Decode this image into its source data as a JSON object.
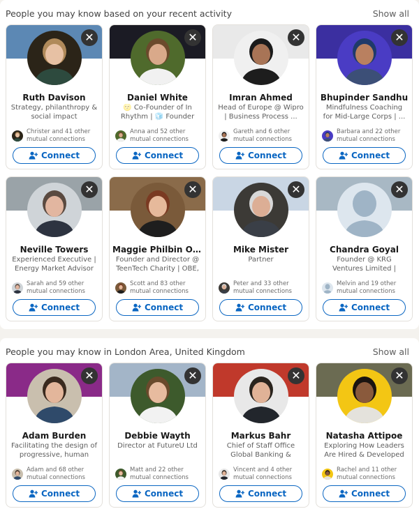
{
  "sections": [
    {
      "title": "People you may know based on your recent activity",
      "show_all": "Show all",
      "cards": [
        {
          "name": "Ruth Davison",
          "headline": "Strategy, philanthropy & social impact",
          "mutual": "Christer and 41 other mutual connections",
          "banner": "#5c88b4",
          "avatar_bg": "#2b2418",
          "skin": "#e7c1a4",
          "hair": "#b08a5a",
          "shirt": "#2d4a3e"
        },
        {
          "name": "Daniel White",
          "headline": "🌝 Co-Founder of In Rhythm | 🧊 Founder &...",
          "mutual": "Anna and 52 other mutual connections",
          "banner": "#1b1b24",
          "avatar_bg": "#4f6a2c",
          "skin": "#d9a98a",
          "hair": "#6b4a2c",
          "shirt": "#f1f1f1"
        },
        {
          "name": "Imran Ahmed",
          "headline": "Head of Europe @ Wipro | Business Process ...",
          "mutual": "Gareth and 6 other mutual connections",
          "banner": "#e9e9e9",
          "avatar_bg": "#f0f0f0",
          "skin": "#a87456",
          "hair": "#1b1b1b",
          "shirt": "#1d1d1d"
        },
        {
          "name": "Bhupinder Sandhu",
          "headline": "Mindfulness Coaching for Mid-Large Corps | ...",
          "mutual": "Barbara and 22 other mutual connections",
          "banner": "#3b2fa0",
          "avatar_bg": "#4a3cc4",
          "skin": "#b98060",
          "hair": "#1f3a6a",
          "shirt": "#3c4f77"
        },
        {
          "name": "Neville Towers",
          "headline": "Experienced Executive | Energy Market Advisor |...",
          "mutual": "Sarah and 59 other mutual connections",
          "banner": "#9aa3a8",
          "avatar_bg": "#cfd4d8",
          "skin": "#e2b6a0",
          "hair": "#5a4a40",
          "shirt": "#2d3340"
        },
        {
          "name": "Maggie Philbin OBE",
          "headline": "Founder and Director @ TeenTech Charity | OBE, ...",
          "mutual": "Scott and 83 other mutual connections",
          "banner": "#8a6b4a",
          "avatar_bg": "#7a5a3a",
          "skin": "#e6b99b",
          "hair": "#7a3a22",
          "shirt": "#1e1e1e"
        },
        {
          "name": "Mike Mister",
          "headline": "Partner",
          "mutual": "Peter and 33 other mutual connections",
          "banner": "#c9d6e4",
          "avatar_bg": "#3c3a36",
          "skin": "#dcae95",
          "hair": "#d8d8d8",
          "shirt": "#3a3f47"
        },
        {
          "name": "Chandra Goyal",
          "headline": "Founder @ KRG Ventures Limited | Managing ...",
          "mutual": "Melvin and 19 other mutual connections",
          "banner": "#a8b8c4",
          "avatar_bg": "#dde6ee",
          "skin": "#9fb4c6",
          "hair": "#9fb4c6",
          "shirt": "#9fb4c6"
        }
      ]
    },
    {
      "title": "People you may know in London Area, United Kingdom",
      "show_all": "Show all",
      "cards": [
        {
          "name": "Adam Burden",
          "headline": "Facilitating the design of progressive, human cen...",
          "mutual": "Adam and 68 other mutual connections",
          "banner": "#8a2a88",
          "avatar_bg": "#c9bfae",
          "skin": "#e3b69b",
          "hair": "#3a2a1e",
          "shirt": "#2f4a6a"
        },
        {
          "name": "Debbie Wayth",
          "headline": "Director at FutureU Ltd",
          "mutual": "Matt and 22 other mutual connections",
          "banner": "#a3b5c8",
          "avatar_bg": "#3d5a2c",
          "skin": "#e7bb9f",
          "hair": "#6a4a2c",
          "shirt": "#f2f2f2"
        },
        {
          "name": "Markus Bahr",
          "headline": "Chief of Staff Office Global Banking & Marke...",
          "mutual": "Vincent and 4 other mutual connections",
          "banner": "#c0392b",
          "avatar_bg": "#e8e8e8",
          "skin": "#e0b297",
          "hair": "#2a241e",
          "shirt": "#22262c"
        },
        {
          "name": "Natasha Attipoe",
          "headline": "Exploring How Leaders Are Hired & Developed |...",
          "mutual": "Rachel and 11 other mutual connections",
          "banner": "#6b6b52",
          "avatar_bg": "#f3c614",
          "skin": "#8a5a3c",
          "hair": "#1a1410",
          "shirt": "#e4e2dc"
        }
      ]
    }
  ],
  "connect_label": "Connect",
  "dismiss_glyph": "✕",
  "colors": {
    "accent": "#0a66c2",
    "dismiss_bg": "#333333",
    "page_bg": "#f4f2ee"
  }
}
